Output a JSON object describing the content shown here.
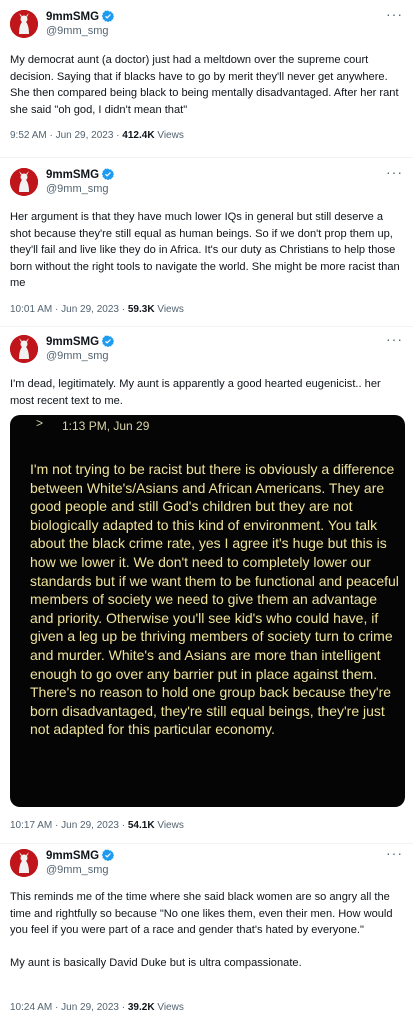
{
  "user": {
    "name": "9mmSMG",
    "handle": "@9mm_smg",
    "verified_color": "#1d9bf0"
  },
  "tweets": [
    {
      "text": "My democrat aunt (a doctor)  just had a meltdown over the supreme court decision. Saying that if blacks have to go by merit they'll never get anywhere. She then compared being black to being mentally disadvantaged. After her rant she said \"oh god, I didn't mean that\"",
      "time": "9:52 AM · Jun 29, 2023 · ",
      "views_count": "412.4K",
      "views_label": " Views"
    },
    {
      "text": "Her argument is that they have much lower IQs in general but still deserve a shot because they're still equal as human beings. So if we don't prop them up, they'll fail and live like they do in Africa. It's our duty as Christians to help those born without the right tools to navigate the world. She might be more racist than me",
      "time": "10:01 AM · Jun 29, 2023 · ",
      "views_count": "59.3K",
      "views_label": " Views"
    },
    {
      "text": "I'm dead, legitimately.  My aunt is apparently a good hearted eugenicist.. her most recent text to me.",
      "time": "10:17 AM · Jun 29, 2023 · ",
      "views_count": "54.1K",
      "views_label": " Views",
      "photo": {
        "time": "1:13 PM, Jun 29",
        "text": "I'm not trying to be racist but there is obviously a difference between White's/Asians and African Americans. They are good people and still God's children but they are not biologically adapted to this kind of environment. You talk about the black crime rate, yes I agree it's huge but this is how we lower it. We don't need to completely lower our standards but if we want them to be functional and peaceful members of society we need to give them an advantage and priority. Otherwise you'll see kid's who could have, if given a leg up be thriving members of society turn to crime and murder. White's and Asians are more than intelligent enough to go over any barrier put in place against them. There's no reason to hold one group back because they're born disadvantaged, they're still equal beings, they're just not adapted for this particular economy."
      }
    },
    {
      "text": "This reminds me of the time where she said black women are so angry all the time and rightfully so because \"No one likes them, even their men. How would you feel if you were part of a race and gender that's hated by everyone.\"\n\nMy aunt is basically David Duke but is ultra compassionate.",
      "time": "10:24 AM · Jun 29, 2023 · ",
      "views_count": "39.2K",
      "views_label": " Views"
    }
  ]
}
